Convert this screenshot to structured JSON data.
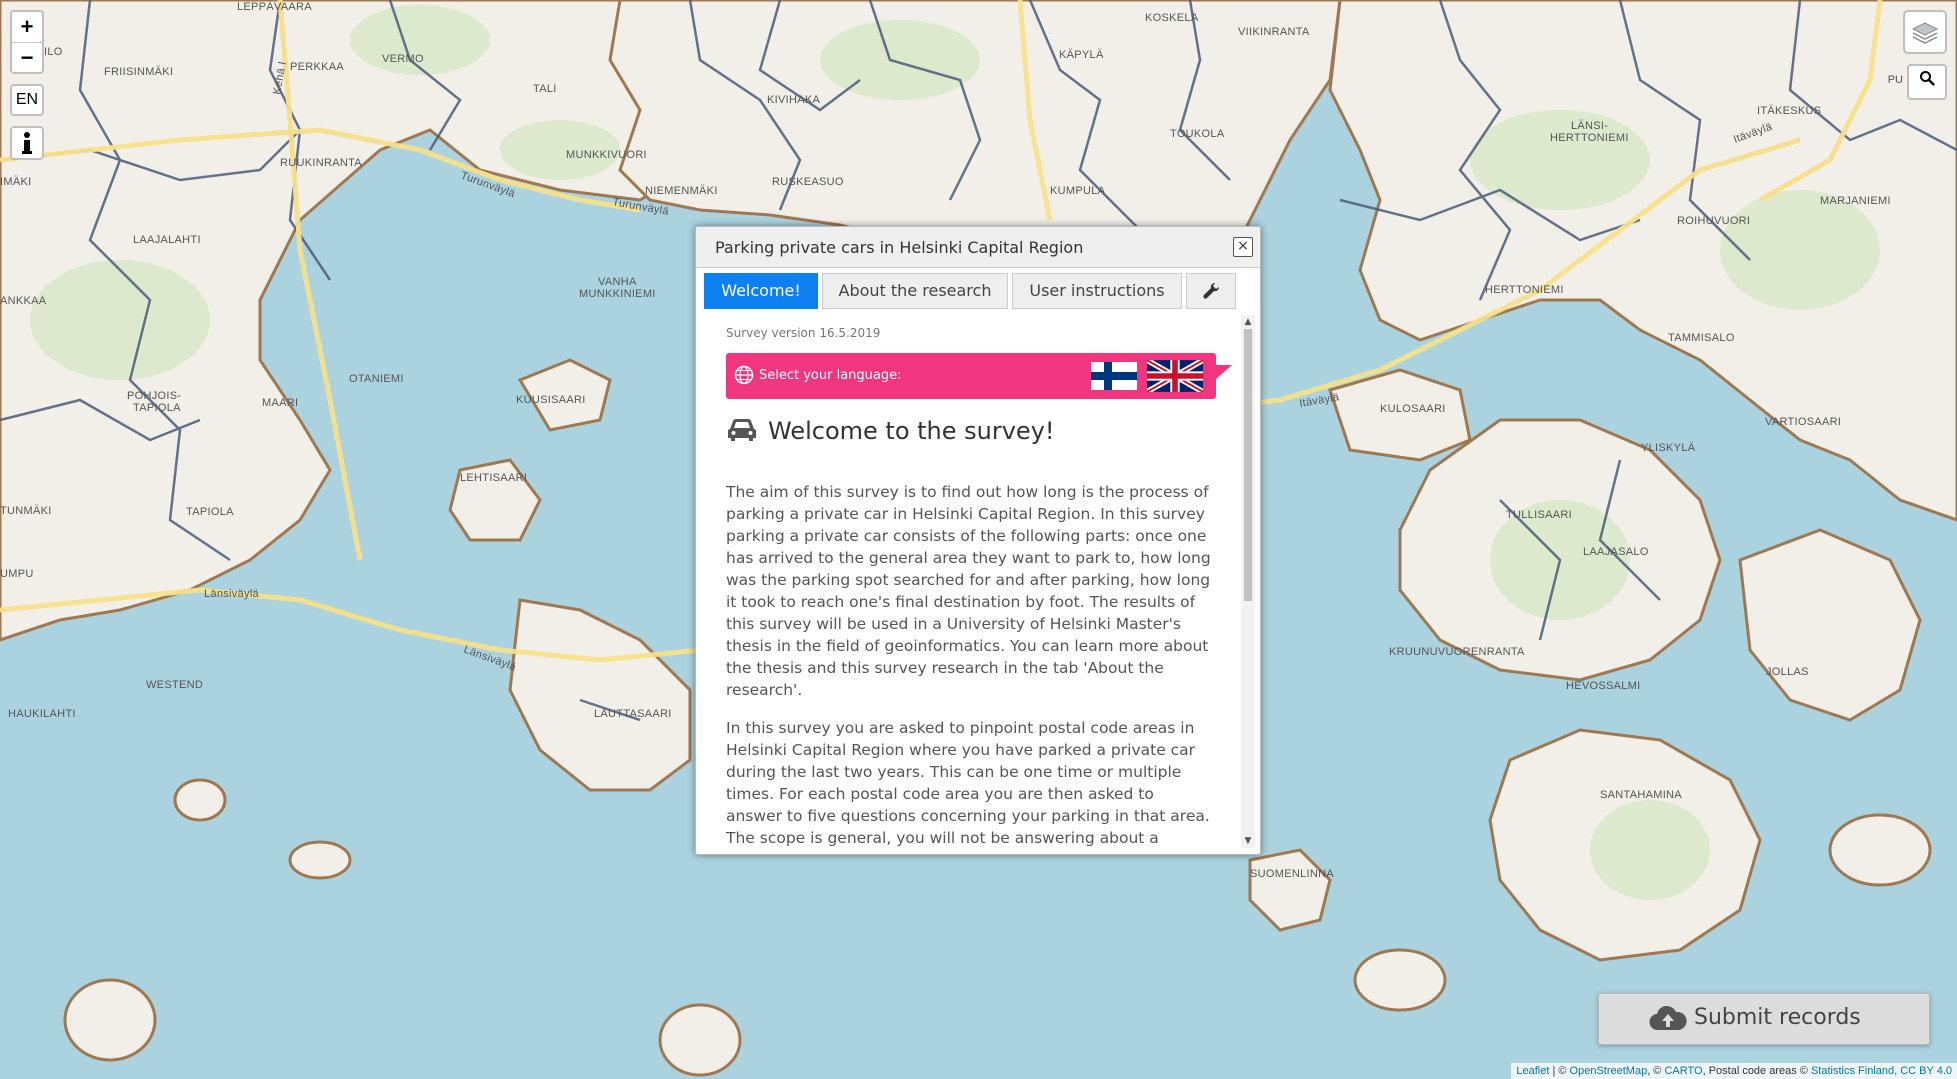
{
  "map": {
    "labels": [
      "LEPPÄVAARA",
      "VERMO",
      "TALI",
      "PERKKAA",
      "FRIISINMÄKI",
      "KIVIHAKA",
      "KÄPYLÄ",
      "KOSKELA",
      "VIIKINRANTA",
      "ITÄKESKUS",
      "LÄNSI-",
      "HERTTONIEMI",
      "MARJANIEMI",
      "MUNKKIVUORI",
      "NIEMENMÄKI",
      "RUSKEASUO",
      "KUMPULA",
      "TOUKOLA",
      "ROIHUVUORI",
      "RUUKINRANTA",
      "LAAJALAHTI",
      "VANHA",
      "MUNKKINIEMI",
      "HERTTONIEMI",
      "TAMMISALO",
      "ANKKAA",
      "OTANIEMI",
      "POHJOIS-",
      "TAPIOLA",
      "MAARI",
      "KUUSISAARI",
      "KULOSAARI",
      "VARTIOSAARI",
      "YLISKYLÄ",
      "LEHTISAARI",
      "TAPIOLA",
      "TUNMÄKI",
      "TULLISAARI",
      "LAAJASALO",
      "UMPU",
      "WESTEND",
      "LAUTTASAARI",
      "KRUUNUVUORENRANTA",
      "JOLLAS",
      "HEVOSSALMI",
      "HAUKILAHTI",
      "SANTAHAMINA",
      "SUOMENLINNA",
      "IMÄKI",
      "ILO",
      "PU"
    ],
    "road_labels": [
      "Turunväylä",
      "Turunväylä",
      "Itäväylä",
      "Itäväylä",
      "Länsiväylä",
      "Länsiväylä",
      "Kehä I",
      "Itäväylä"
    ]
  },
  "controls": {
    "zoom_in": "+",
    "zoom_out": "−",
    "language": "EN",
    "info_icon": "info-icon",
    "layers_icon": "layers-icon",
    "search_icon": "search-icon",
    "search_prefix": "PU"
  },
  "dialog": {
    "title": "Parking private cars in Helsinki Capital Region",
    "close": "×",
    "tabs": [
      {
        "label": "Welcome!",
        "active": true
      },
      {
        "label": "About the research",
        "active": false
      },
      {
        "label": "User instructions",
        "active": false
      }
    ],
    "settings_tab_icon": "wrench-icon",
    "version": "Survey version 16.5.2019",
    "language_prompt": "Select your language:",
    "languages": [
      "fi",
      "en"
    ],
    "welcome_title": "Welcome to the survey!",
    "paragraph1": "The aim of this survey is to find out how long is the process of parking a private car in Helsinki Capital Region. In this survey parking a private car consists of the following parts: once one has arrived to the general area they want to park to, how long was the parking spot searched for and after parking, how long it took to reach one's final destination by foot. The results of this survey will be used in a University of Helsinki Master's thesis in the field of geoinformatics. You can learn more about the thesis and this survey research in the tab 'About the research'.",
    "paragraph2": "In this survey you are asked to pinpoint postal code areas in Helsinki Capital Region where you have parked a private car during the last two years. This can be one time or multiple times. For each postal code area you are then asked to answer to five questions concerning your parking in that area. The scope is general, you will not be answering about a"
  },
  "submit": {
    "label": "Submit records",
    "icon": "cloud-upload-icon"
  },
  "attribution": {
    "leaflet": "Leaflet",
    "sep1": " | © ",
    "osm": "OpenStreetMap",
    "sep2": ", © ",
    "carto": "CARTO",
    "sep3": ", Postal code areas © ",
    "stats": "Statistics Finland, CC BY 4.0"
  },
  "colors": {
    "water": "#aad3df",
    "land": "#f2efe9",
    "park": "#d8e8c8",
    "shoreline": "#a07850",
    "postal_boundary": "#4a5a7a",
    "road": "#f7e08a",
    "tab_active": "#0d80f2",
    "language_bar": "#f2357f"
  }
}
